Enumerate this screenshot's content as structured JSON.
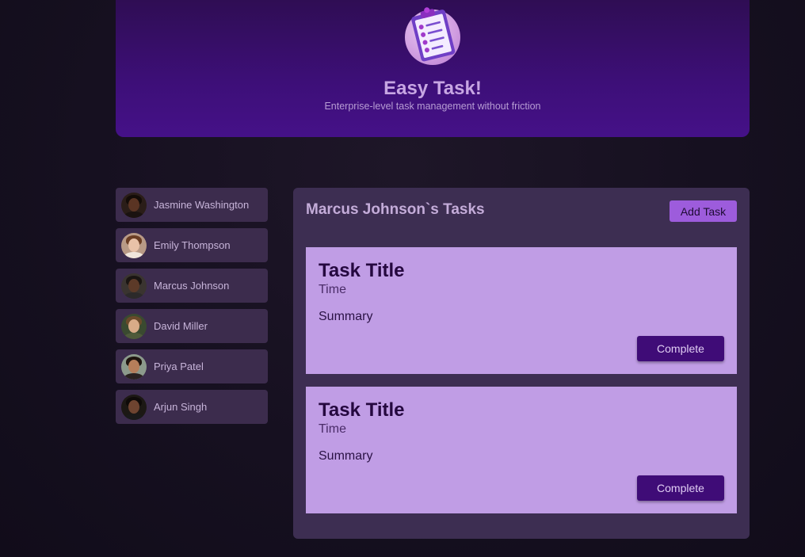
{
  "app": {
    "title": "Easy Task!",
    "subtitle": "Enterprise-level task management without friction",
    "logo_icon": "clipboard-checklist-icon"
  },
  "sidebar": {
    "users": [
      {
        "name": "Jasmine Washington",
        "avatar": "avatar-photo"
      },
      {
        "name": "Emily Thompson",
        "avatar": "avatar-photo"
      },
      {
        "name": "Marcus Johnson",
        "avatar": "avatar-photo"
      },
      {
        "name": "David Miller",
        "avatar": "avatar-photo"
      },
      {
        "name": "Priya Patel",
        "avatar": "avatar-photo"
      },
      {
        "name": "Arjun Singh",
        "avatar": "avatar-photo"
      }
    ]
  },
  "tasks_panel": {
    "title": "Marcus Johnson`s Tasks",
    "add_label": "Add Task",
    "tasks": [
      {
        "title": "Task Title",
        "time": "Time",
        "summary": "Summary",
        "action_label": "Complete"
      },
      {
        "title": "Task Title",
        "time": "Time",
        "summary": "Summary",
        "action_label": "Complete"
      }
    ]
  },
  "colors": {
    "header_bg": "#3d0f78",
    "panel_bg": "#3d2e52",
    "card_bg": "#c09de5",
    "accent_button": "#9d5cdc",
    "complete_button": "#3f0c77"
  }
}
